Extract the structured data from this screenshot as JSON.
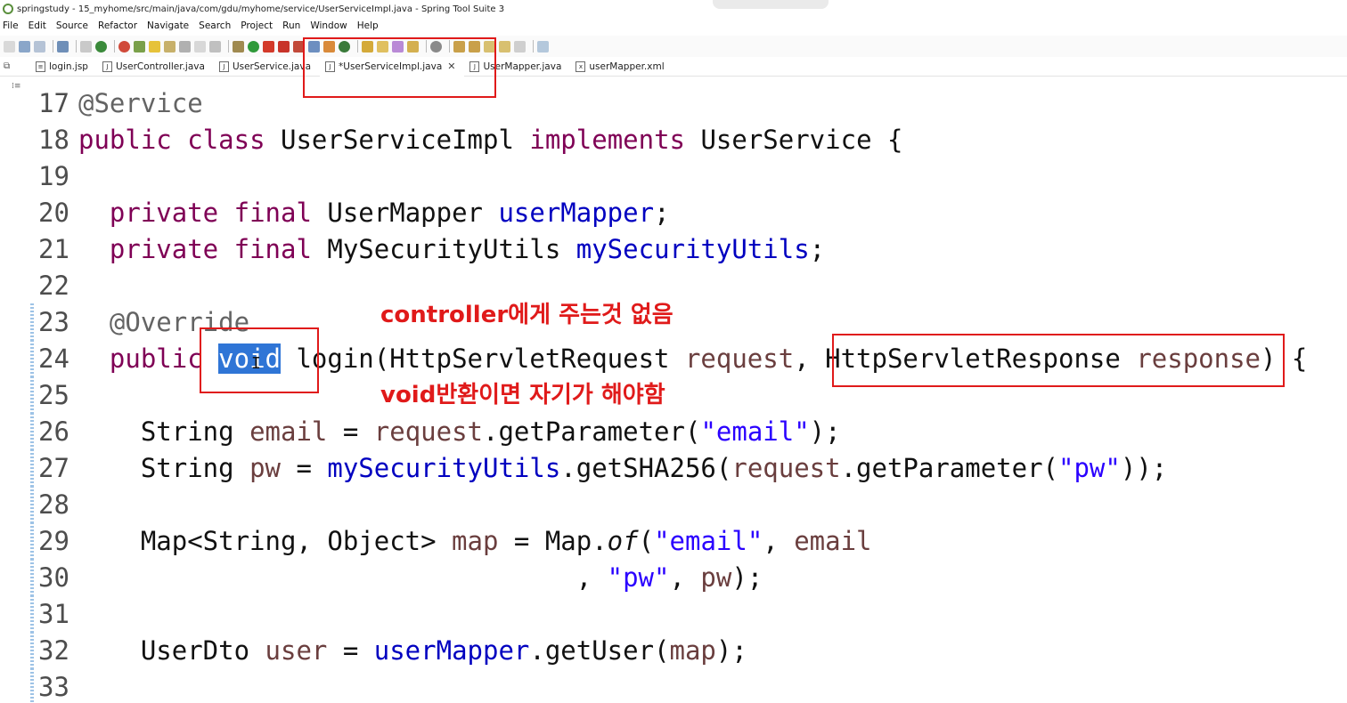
{
  "window": {
    "title": "springstudy - 15_myhome/src/main/java/com/gdu/myhome/service/UserServiceImpl.java - Spring Tool Suite 3"
  },
  "menu": [
    "File",
    "Edit",
    "Source",
    "Refactor",
    "Navigate",
    "Search",
    "Project",
    "Run",
    "Window",
    "Help"
  ],
  "tabs": [
    {
      "label": "login.jsp",
      "icon": "jsp-file-icon"
    },
    {
      "label": "UserController.java",
      "icon": "java-file-icon"
    },
    {
      "label": "UserService.java",
      "icon": "java-file-icon"
    },
    {
      "label": "*UserServiceImpl.java",
      "icon": "java-file-icon",
      "active": true
    },
    {
      "label": "UserMapper.java",
      "icon": "java-file-icon"
    },
    {
      "label": "userMapper.xml",
      "icon": "xml-file-icon"
    }
  ],
  "gutter": [
    "17",
    "18",
    "19",
    "20",
    "21",
    "22",
    "23",
    "24",
    "25",
    "26",
    "27",
    "28",
    "29",
    "30",
    "31",
    "32",
    "33"
  ],
  "code": {
    "l17": "@Service",
    "l18_kw1": "public",
    "l18_kw2": "class",
    "l18_name": "UserServiceImpl",
    "l18_kw3": "implements",
    "l18_iface": "UserService {",
    "l20_kw1": "private",
    "l20_kw2": "final",
    "l20_type": "UserMapper",
    "l20_field": "userMapper",
    "l21_kw1": "private",
    "l21_kw2": "final",
    "l21_type": "MySecurityUtils",
    "l21_field": "mySecurityUtils",
    "l23": "@Override",
    "l24_kw1": "public",
    "l24_kw2": "void",
    "l24_m": "login(HttpServletRequest",
    "l24_p1": "request",
    "l24_t2": "HttpServletResponse",
    "l24_p2": "response",
    "l26_type": "String",
    "l26_var": "email",
    "l26_obj": "request",
    "l26_call": ".getParameter(",
    "l26_str": "\"email\"",
    "l27_type": "String",
    "l27_var": "pw",
    "l27_fld": "mySecurityUtils",
    "l27_call": ".getSHA256(",
    "l27_obj": "request",
    "l27_call2": ".getParameter(",
    "l27_str": "\"pw\"",
    "l29_type": "Map<String, Object>",
    "l29_var": "map",
    "l29_cls": "Map.",
    "l29_of": "of",
    "l29_str": "\"email\"",
    "l29_arg": "email",
    "l30_str": "\"pw\"",
    "l30_arg": "pw",
    "l32_type": "UserDto",
    "l32_var": "user",
    "l32_fld": "userMapper",
    "l32_call": ".getUser(",
    "l32_arg": "map"
  },
  "annotations": {
    "note1": "controller에게 주는것 없음",
    "note2": "void반환이면 자기가 해야함"
  },
  "colors": {
    "keyword": "#7f0055",
    "field": "#0000c0",
    "string": "#2a00ff",
    "annotation_red": "#e01a1a",
    "selection": "#2f75d6"
  }
}
